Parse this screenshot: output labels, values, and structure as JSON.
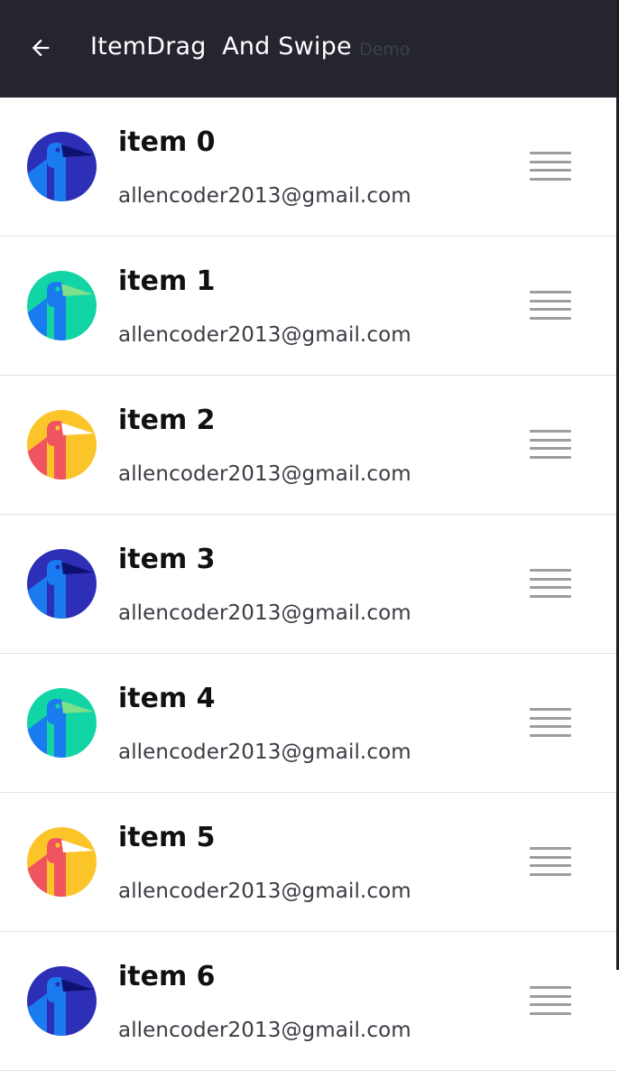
{
  "appbar": {
    "back_icon": "arrow-back-icon",
    "title": "ItemDrag  And Swipe",
    "subtitle": "Demo",
    "background": "#24252f"
  },
  "list": {
    "items": [
      {
        "title": "item 0",
        "email": "allencoder2013@gmail.com",
        "avatar": "bird-avatar-icon",
        "avatar_bg": "#2d2fb6",
        "bird_color": "#1a7bf0",
        "beak_color": "#0e1170"
      },
      {
        "title": "item 1",
        "email": "allencoder2013@gmail.com",
        "avatar": "bird-avatar-icon",
        "avatar_bg": "#12d5a6",
        "bird_color": "#1a7bf0",
        "beak_color": "#7de08a"
      },
      {
        "title": "item 2",
        "email": "allencoder2013@gmail.com",
        "avatar": "bird-avatar-icon",
        "avatar_bg": "#fbc52a",
        "bird_color": "#f0545f",
        "beak_color": "#ffffff"
      },
      {
        "title": "item 3",
        "email": "allencoder2013@gmail.com",
        "avatar": "bird-avatar-icon",
        "avatar_bg": "#2d2fb6",
        "bird_color": "#1a7bf0",
        "beak_color": "#0e1170"
      },
      {
        "title": "item 4",
        "email": "allencoder2013@gmail.com",
        "avatar": "bird-avatar-icon",
        "avatar_bg": "#12d5a6",
        "bird_color": "#1a7bf0",
        "beak_color": "#7de08a"
      },
      {
        "title": "item 5",
        "email": "allencoder2013@gmail.com",
        "avatar": "bird-avatar-icon",
        "avatar_bg": "#fbc52a",
        "bird_color": "#f0545f",
        "beak_color": "#ffffff"
      },
      {
        "title": "item 6",
        "email": "allencoder2013@gmail.com",
        "avatar": "bird-avatar-icon",
        "avatar_bg": "#2d2fb6",
        "bird_color": "#1a7bf0",
        "beak_color": "#0e1170"
      }
    ],
    "drag_icon": "drag-handle-icon"
  }
}
